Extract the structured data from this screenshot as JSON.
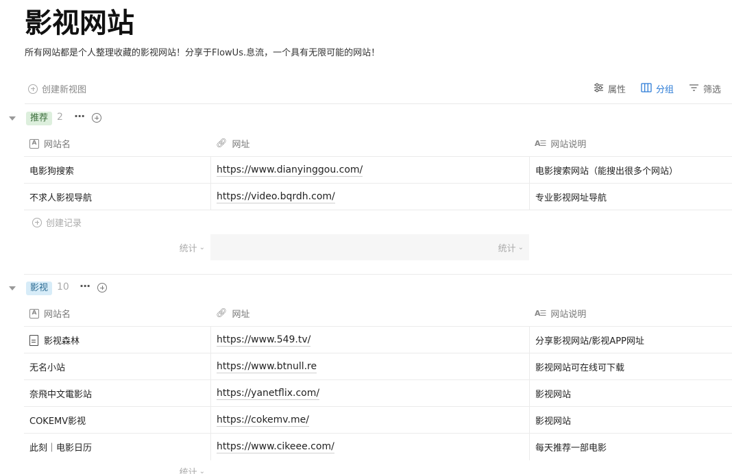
{
  "page": {
    "title": "影视网站",
    "subtitle": "所有网站都是个人整理收藏的影视网站！分享于FlowUs.息流，一个具有无限可能的网站！"
  },
  "toolbar": {
    "new_view": "创建新视图",
    "properties": "属性",
    "group": "分组",
    "filter": "筛选"
  },
  "columns": {
    "name": "网站名",
    "url": "网址",
    "desc": "网站说明"
  },
  "groups": [
    {
      "tag": "推荐",
      "count": "2",
      "rows": [
        {
          "name": "电影狗搜索",
          "url": "https://www.dianyinggou.com/",
          "desc": "电影搜索网站（能搜出很多个网站）"
        },
        {
          "name": "不求人影视导航",
          "url": "https://video.bqrdh.com/",
          "desc": "专业影视网址导航"
        }
      ],
      "new_record": "创建记录",
      "stat_label": "统计"
    },
    {
      "tag": "影视",
      "count": "10",
      "rows": [
        {
          "name": "影视森林",
          "url": "https://www.549.tv/",
          "desc": "分享影视网站/影视APP网址"
        },
        {
          "name": "无名小站",
          "url": "https://www.btnull.re",
          "desc": "影视网站可在线可下载"
        },
        {
          "name": "奈飛中文電影站",
          "url": "https://yanetflix.com/",
          "desc": "影视网站"
        },
        {
          "name": "COKEMV影视",
          "url": "https://cokemv.me/",
          "desc": "影视网站"
        },
        {
          "name": "此刻｜电影日历",
          "url": "https://www.cikeee.com/",
          "desc": "每天推荐一部电影"
        }
      ],
      "stat_label": "统计"
    }
  ],
  "colors": {
    "accent": "#2b7bd6",
    "tag_green": "#ddefdd",
    "tag_blue": "#d7ecf8"
  }
}
